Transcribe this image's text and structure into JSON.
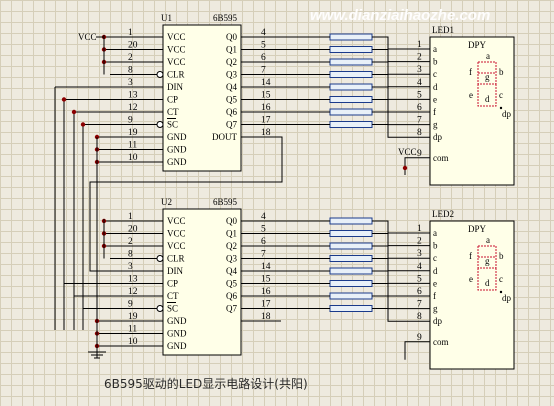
{
  "watermark": "www.dianziaihaozhe.com",
  "caption": "6B595驱动的LED显示电路设计(共阳)",
  "vcc_label": "VCC",
  "chips": [
    {
      "ref": "U1",
      "part": "6B595",
      "left_pins": [
        {
          "num": "1",
          "name": "VCC"
        },
        {
          "num": "20",
          "name": "VCC"
        },
        {
          "num": "2",
          "name": "VCC"
        },
        {
          "num": "8",
          "name": "CLR"
        },
        {
          "num": "3",
          "name": "DIN"
        },
        {
          "num": "13",
          "name": "CP"
        },
        {
          "num": "12",
          "name": "CT"
        },
        {
          "num": "9",
          "name": "SC"
        },
        {
          "num": "19",
          "name": "GND"
        },
        {
          "num": "11",
          "name": "GND"
        },
        {
          "num": "10",
          "name": "GND"
        }
      ],
      "right_pins": [
        {
          "num": "4",
          "name": "Q0"
        },
        {
          "num": "5",
          "name": "Q1"
        },
        {
          "num": "6",
          "name": "Q2"
        },
        {
          "num": "7",
          "name": "Q3"
        },
        {
          "num": "14",
          "name": "Q4"
        },
        {
          "num": "15",
          "name": "Q5"
        },
        {
          "num": "16",
          "name": "Q6"
        },
        {
          "num": "17",
          "name": "Q7"
        },
        {
          "num": "18",
          "name": "DOUT"
        }
      ]
    },
    {
      "ref": "U2",
      "part": "6B595",
      "left_pins": [
        {
          "num": "1",
          "name": "VCC"
        },
        {
          "num": "20",
          "name": "VCC"
        },
        {
          "num": "2",
          "name": "VCC"
        },
        {
          "num": "8",
          "name": "CLR"
        },
        {
          "num": "3",
          "name": "DIN"
        },
        {
          "num": "13",
          "name": "CP"
        },
        {
          "num": "12",
          "name": "CT"
        },
        {
          "num": "9",
          "name": "SC"
        },
        {
          "num": "19",
          "name": "GND"
        },
        {
          "num": "11",
          "name": "GND"
        },
        {
          "num": "10",
          "name": "GND"
        }
      ],
      "right_pins": [
        {
          "num": "4",
          "name": "Q0"
        },
        {
          "num": "5",
          "name": "Q1"
        },
        {
          "num": "6",
          "name": "Q2"
        },
        {
          "num": "7",
          "name": "Q3"
        },
        {
          "num": "14",
          "name": "Q4"
        },
        {
          "num": "15",
          "name": "Q5"
        },
        {
          "num": "16",
          "name": "Q6"
        },
        {
          "num": "17",
          "name": "Q7"
        },
        {
          "num": "18",
          "name": ""
        }
      ]
    }
  ],
  "leds": [
    {
      "ref": "LED1",
      "part": "DPY",
      "pins": [
        {
          "num": "1",
          "name": "a"
        },
        {
          "num": "2",
          "name": "b"
        },
        {
          "num": "3",
          "name": "c"
        },
        {
          "num": "4",
          "name": "d"
        },
        {
          "num": "5",
          "name": "e"
        },
        {
          "num": "6",
          "name": "f"
        },
        {
          "num": "7",
          "name": "g"
        },
        {
          "num": "8",
          "name": "dp"
        },
        {
          "num": "9",
          "name": "com"
        }
      ],
      "seg_labels": [
        "a",
        "f",
        "g",
        "b",
        "e",
        "c",
        "d",
        "dp"
      ]
    },
    {
      "ref": "LED2",
      "part": "DPY",
      "pins": [
        {
          "num": "1",
          "name": "a"
        },
        {
          "num": "2",
          "name": "b"
        },
        {
          "num": "3",
          "name": "c"
        },
        {
          "num": "4",
          "name": "d"
        },
        {
          "num": "5",
          "name": "e"
        },
        {
          "num": "6",
          "name": "f"
        },
        {
          "num": "7",
          "name": "g"
        },
        {
          "num": "8",
          "name": "dp"
        },
        {
          "num": "9",
          "name": "com"
        }
      ],
      "seg_labels": [
        "a",
        "f",
        "g",
        "b",
        "e",
        "c",
        "d",
        "dp"
      ]
    }
  ]
}
